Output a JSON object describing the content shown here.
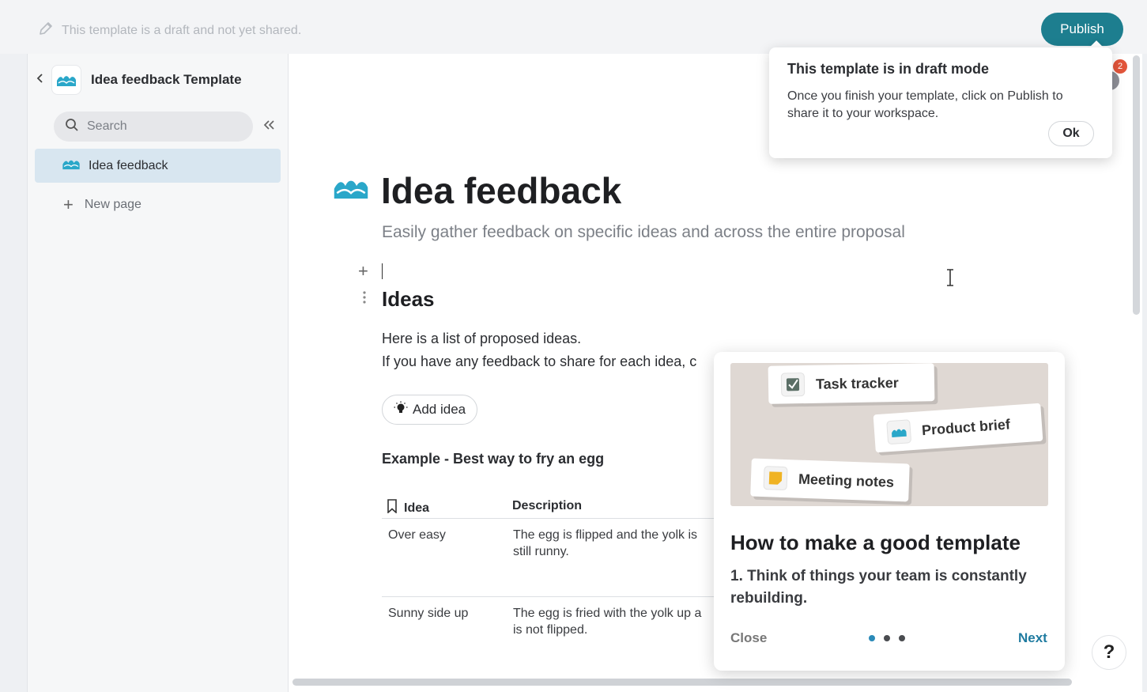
{
  "topbar": {
    "draft_note": "This template is a draft and not yet shared.",
    "publish_label": "Publish"
  },
  "sidebar": {
    "title": "Idea feedback Template",
    "search_placeholder": "Search",
    "items": [
      {
        "label": "Idea feedback"
      }
    ],
    "new_page_label": "New page"
  },
  "page": {
    "title": "Idea feedback",
    "subtitle": "Easily gather feedback on specific ideas and across the entire proposal",
    "heading": "Ideas",
    "para1": "Here is a list of proposed ideas.",
    "para2": "If you have any feedback to share for each idea, c",
    "add_idea_label": "Add idea",
    "example_heading": "Example - Best way to fry an egg",
    "table": {
      "headers": [
        "Idea",
        "Description"
      ],
      "rows": [
        {
          "idea": "Over easy",
          "desc_line1": "The egg is flipped and the yolk is",
          "desc_line2": "still runny."
        },
        {
          "idea": "Sunny side up",
          "desc_line1": "The egg is fried with the yolk up a",
          "desc_line2": "is not flipped."
        }
      ]
    }
  },
  "popover": {
    "title": "This template is in draft mode",
    "body": "Once you finish your template, click on Publish to share it to your workspace.",
    "ok_label": "Ok"
  },
  "notifications": {
    "count": "2"
  },
  "guide": {
    "chips": [
      "Task tracker",
      "Product brief",
      "Meeting notes"
    ],
    "title": "How to make a good template",
    "body": "1. Think of things your team is constantly rebuilding.",
    "close_label": "Close",
    "next_label": "Next",
    "step": 1,
    "total_steps": 3
  },
  "help_label": "?",
  "colors": {
    "accent": "#1d7e8f",
    "selected_item": "#d8e6f0",
    "link": "#1f7ba0",
    "badge": "#e2553b"
  },
  "icons": [
    "pencil-icon",
    "chevron-left-icon",
    "wave-logo-icon",
    "search-icon",
    "double-chevron-left-icon",
    "plus-icon",
    "drag-handle-icon",
    "lightbulb-icon",
    "bookmark-icon",
    "help-icon"
  ]
}
